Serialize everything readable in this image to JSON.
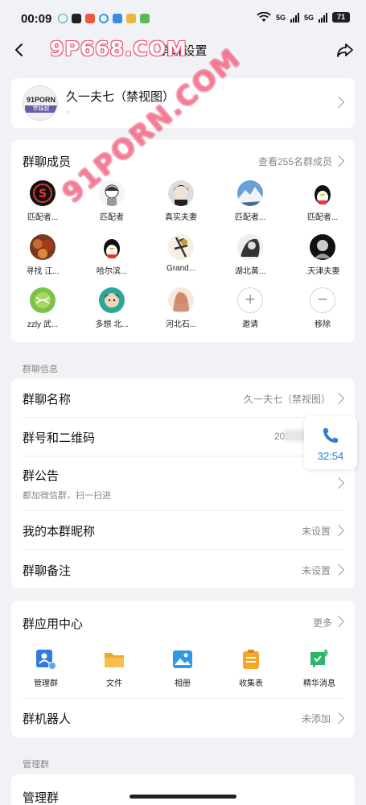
{
  "status_bar": {
    "time": "00:09",
    "signal1": "5G",
    "signal2": "5G",
    "battery": "71"
  },
  "nav": {
    "title": "群聊设置"
  },
  "watermarks": {
    "top": "9P668.COM",
    "diagonal": "91PORN.COM"
  },
  "group": {
    "name": "久一夫七（禁视图）",
    "sub": "-",
    "avatar_text1": "91PORN",
    "avatar_text2": "学妹叔"
  },
  "members": {
    "title": "群聊成员",
    "view_all": "查看255名群成员",
    "items": [
      {
        "name": "匹配者..."
      },
      {
        "name": "匹配者"
      },
      {
        "name": "真实夫妻"
      },
      {
        "name": "匹配者..."
      },
      {
        "name": "匹配者..."
      },
      {
        "name": "寻找 江..."
      },
      {
        "name": "哈尔滨..."
      },
      {
        "name": "Grand..."
      },
      {
        "name": "湖北黄..."
      },
      {
        "name": ".天津夫妻"
      },
      {
        "name": "zzly 武..."
      },
      {
        "name": "多想 北..."
      },
      {
        "name": "河北石..."
      }
    ],
    "invite": "邀请",
    "remove": "移除"
  },
  "info": {
    "section_label": "群聊信息",
    "name_label": "群聊名称",
    "name_value": "久一夫七（禁视图）",
    "number_label": "群号和二维码",
    "number_value": "205",
    "notice_label": "群公告",
    "notice_value": "都加微信群，扫一扫进",
    "nickname_label": "我的本群昵称",
    "nickname_value": "未设置",
    "remark_label": "群聊备注",
    "remark_value": "未设置"
  },
  "call": {
    "time": "32:54"
  },
  "apps": {
    "title": "群应用中心",
    "more": "更多",
    "items": [
      {
        "label": "管理群",
        "icon": "manage-group-icon"
      },
      {
        "label": "文件",
        "icon": "folder-icon"
      },
      {
        "label": "相册",
        "icon": "album-icon"
      },
      {
        "label": "收集表",
        "icon": "form-icon"
      },
      {
        "label": "精华消息",
        "icon": "featured-message-icon"
      }
    ],
    "robot_label": "群机器人",
    "robot_value": "未添加"
  },
  "manage": {
    "section_label": "管理群",
    "row_label": "管理群"
  },
  "colors": {
    "accent": "#2f7cdc",
    "page_bg": "#f1f2f6",
    "watermark": "#ef4d6e"
  }
}
